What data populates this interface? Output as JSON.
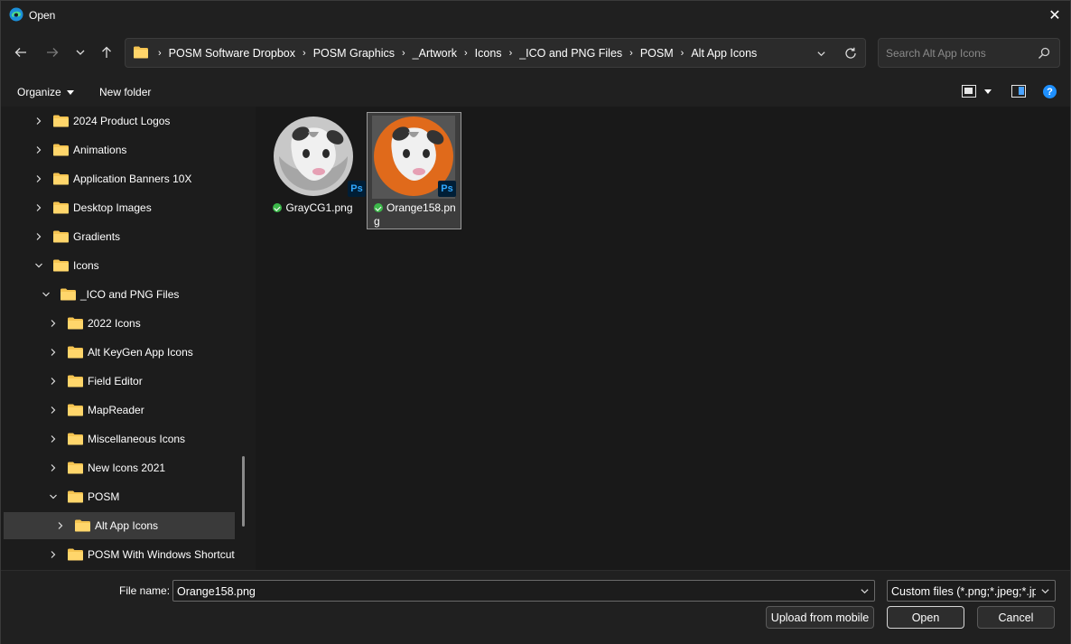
{
  "window": {
    "title": "Open",
    "close_label": "✕"
  },
  "nav": {
    "path": [
      "POSM Software Dropbox",
      "POSM Graphics",
      "_Artwork",
      "Icons",
      "_ICO and PNG Files",
      "POSM",
      "Alt App Icons"
    ],
    "separator": "›",
    "search_placeholder": "Search Alt App Icons"
  },
  "commands": {
    "organize": "Organize",
    "new_folder": "New folder",
    "help": "?"
  },
  "sidebar": {
    "items": [
      {
        "label": "2024 Product Logos",
        "expanded": false
      },
      {
        "label": "Animations",
        "expanded": false
      },
      {
        "label": "Application Banners 10X",
        "expanded": false
      },
      {
        "label": "Desktop Images",
        "expanded": false
      },
      {
        "label": "Gradients",
        "expanded": false
      },
      {
        "label": "Icons",
        "expanded": true
      },
      {
        "label": "_ICO and PNG Files",
        "expanded": true
      },
      {
        "label": "2022 Icons",
        "expanded": false
      },
      {
        "label": "Alt KeyGen App Icons",
        "expanded": false
      },
      {
        "label": "Field Editor",
        "expanded": false
      },
      {
        "label": "MapReader",
        "expanded": false
      },
      {
        "label": "Miscellaneous Icons",
        "expanded": false
      },
      {
        "label": "New Icons 2021",
        "expanded": false
      },
      {
        "label": "POSM",
        "expanded": true
      },
      {
        "label": "Alt App Icons",
        "expanded": false,
        "selected": true
      },
      {
        "label": "POSM With Windows Shortcut",
        "expanded": false
      }
    ]
  },
  "files": [
    {
      "name": "GrayCG1.png",
      "badge": "Ps",
      "bg_color": "#c8c8c8",
      "selected": false
    },
    {
      "name": "Orange158.png",
      "badge": "Ps",
      "bg_color": "#e06a1b",
      "selected": true
    }
  ],
  "footer": {
    "file_name_label": "File name:",
    "file_name_value": "Orange158.png",
    "file_type_value": "Custom files (*.png;*.jpeg;*.jpg",
    "upload_label": "Upload from mobile",
    "open_label": "Open",
    "cancel_label": "Cancel"
  },
  "colors": {
    "accent": "#1e90ff",
    "sync_green": "#3cb84a",
    "folder_yellow": "#f5c451",
    "ps_blue": "#31a8ff"
  }
}
